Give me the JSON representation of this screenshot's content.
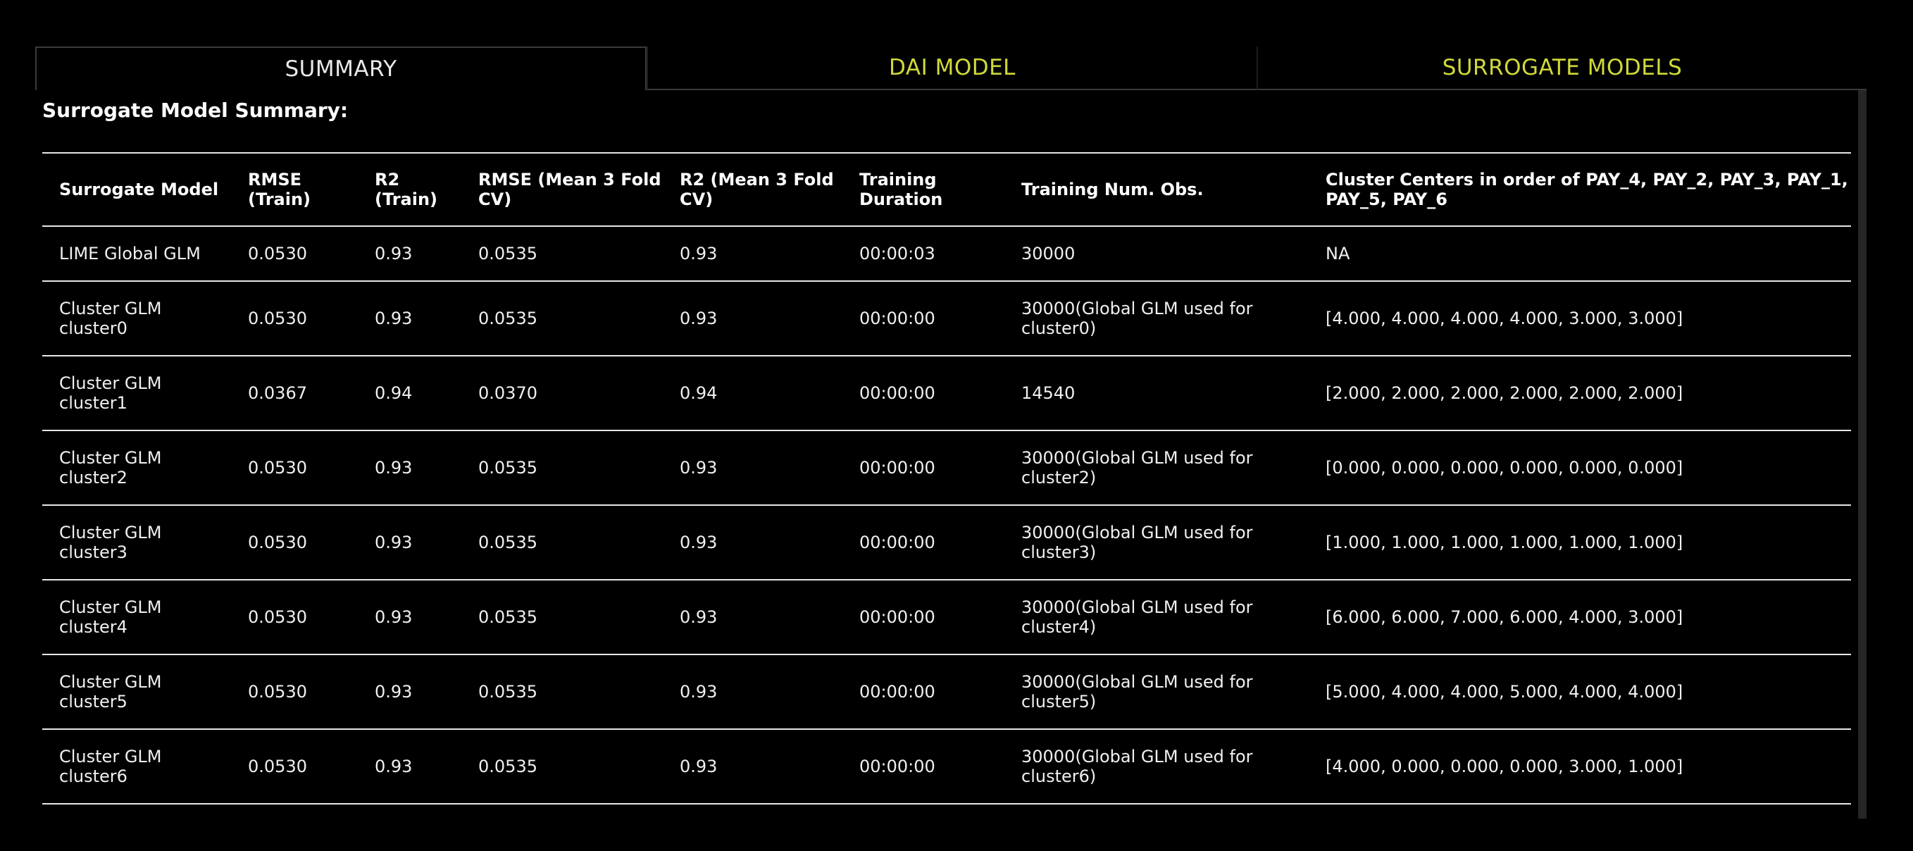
{
  "tabs": [
    {
      "label": "SUMMARY",
      "active": true
    },
    {
      "label": "DAI MODEL",
      "active": false
    },
    {
      "label": "SURROGATE MODELS",
      "active": false
    }
  ],
  "panel": {
    "title": "Surrogate Model Summary:"
  },
  "colors": {
    "accent": "#cfd93a",
    "background": "#000000",
    "text": "#ffffff"
  },
  "table": {
    "headers": [
      "Surrogate Model",
      "RMSE (Train)",
      "R2 (Train)",
      "RMSE (Mean 3 Fold CV)",
      "R2 (Mean 3 Fold CV)",
      "Training Duration",
      "Training Num. Obs.",
      "Cluster Centers in order of PAY_4, PAY_2, PAY_3, PAY_1, PAY_5, PAY_6"
    ],
    "rows": [
      [
        "LIME Global GLM",
        "0.0530",
        "0.93",
        "0.0535",
        "0.93",
        "00:00:03",
        "30000",
        "NA"
      ],
      [
        "Cluster GLM cluster0",
        "0.0530",
        "0.93",
        "0.0535",
        "0.93",
        "00:00:00",
        "30000(Global GLM used for cluster0)",
        "[4.000, 4.000, 4.000, 4.000, 3.000, 3.000]"
      ],
      [
        "Cluster GLM cluster1",
        "0.0367",
        "0.94",
        "0.0370",
        "0.94",
        "00:00:00",
        "14540",
        "[2.000, 2.000, 2.000, 2.000, 2.000, 2.000]"
      ],
      [
        "Cluster GLM cluster2",
        "0.0530",
        "0.93",
        "0.0535",
        "0.93",
        "00:00:00",
        "30000(Global GLM used for cluster2)",
        "[0.000, 0.000, 0.000, 0.000, 0.000, 0.000]"
      ],
      [
        "Cluster GLM cluster3",
        "0.0530",
        "0.93",
        "0.0535",
        "0.93",
        "00:00:00",
        "30000(Global GLM used for cluster3)",
        "[1.000, 1.000, 1.000, 1.000, 1.000, 1.000]"
      ],
      [
        "Cluster GLM cluster4",
        "0.0530",
        "0.93",
        "0.0535",
        "0.93",
        "00:00:00",
        "30000(Global GLM used for cluster4)",
        "[6.000, 6.000, 7.000, 6.000, 4.000, 3.000]"
      ],
      [
        "Cluster GLM cluster5",
        "0.0530",
        "0.93",
        "0.0535",
        "0.93",
        "00:00:00",
        "30000(Global GLM used for cluster5)",
        "[5.000, 4.000, 4.000, 5.000, 4.000, 4.000]"
      ],
      [
        "Cluster GLM cluster6",
        "0.0530",
        "0.93",
        "0.0535",
        "0.93",
        "00:00:00",
        "30000(Global GLM used for cluster6)",
        "[4.000, 0.000, 0.000, 0.000, 3.000, 1.000]"
      ]
    ]
  }
}
